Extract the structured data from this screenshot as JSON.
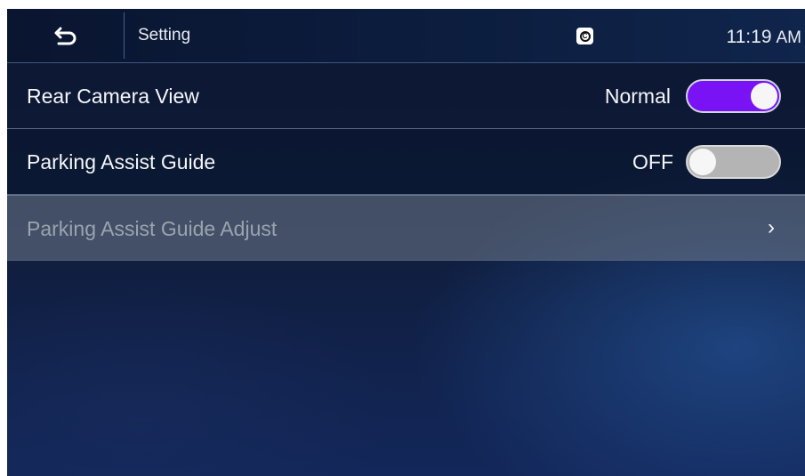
{
  "header": {
    "back_icon": "back-arrow-icon",
    "title": "Setting",
    "status_icon": "carplay-c-icon",
    "status_icon_letter": "C",
    "time": "11:19",
    "ampm": "AM"
  },
  "settings": [
    {
      "label": "Rear Camera View",
      "status": "Normal",
      "toggle": "on",
      "toggle_color": "#7a12f6"
    },
    {
      "label": "Parking Assist Guide",
      "status": "OFF",
      "toggle": "off",
      "toggle_color": "#b4b4b4"
    },
    {
      "label": "Parking Assist Guide Adjust",
      "chevron": "›",
      "chevron_icon": "chevron-right-icon",
      "disabled": true
    }
  ]
}
